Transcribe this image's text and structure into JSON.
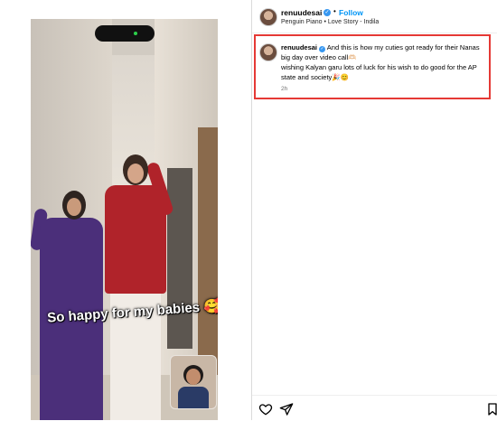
{
  "post": {
    "username": "renuudesai",
    "follow_label": "Follow",
    "separator": "•",
    "audio": {
      "artist": "Penguin Piano",
      "separator": " • ",
      "track": "Love Story - Indila"
    }
  },
  "media": {
    "overlay_caption": "So happy for my babies 🥰"
  },
  "caption": {
    "username": "renuudesai",
    "line1": "And this is how my cuties got ready for their Nanas big day over video call🫶🏻",
    "line2": "wishing Kalyan garu lots of luck for his wish to do good for the AP state and society🎉😊",
    "time": "2h"
  },
  "icons": {
    "verified": "verified-badge-icon",
    "like": "heart-icon",
    "share": "paper-plane-icon",
    "save": "bookmark-icon"
  },
  "colors": {
    "follow": "#0095f6",
    "verified": "#3797f0",
    "highlight_border": "#e53935",
    "girl_outfit": "#4b2f7a",
    "boy_shirt": "#b0232a"
  }
}
